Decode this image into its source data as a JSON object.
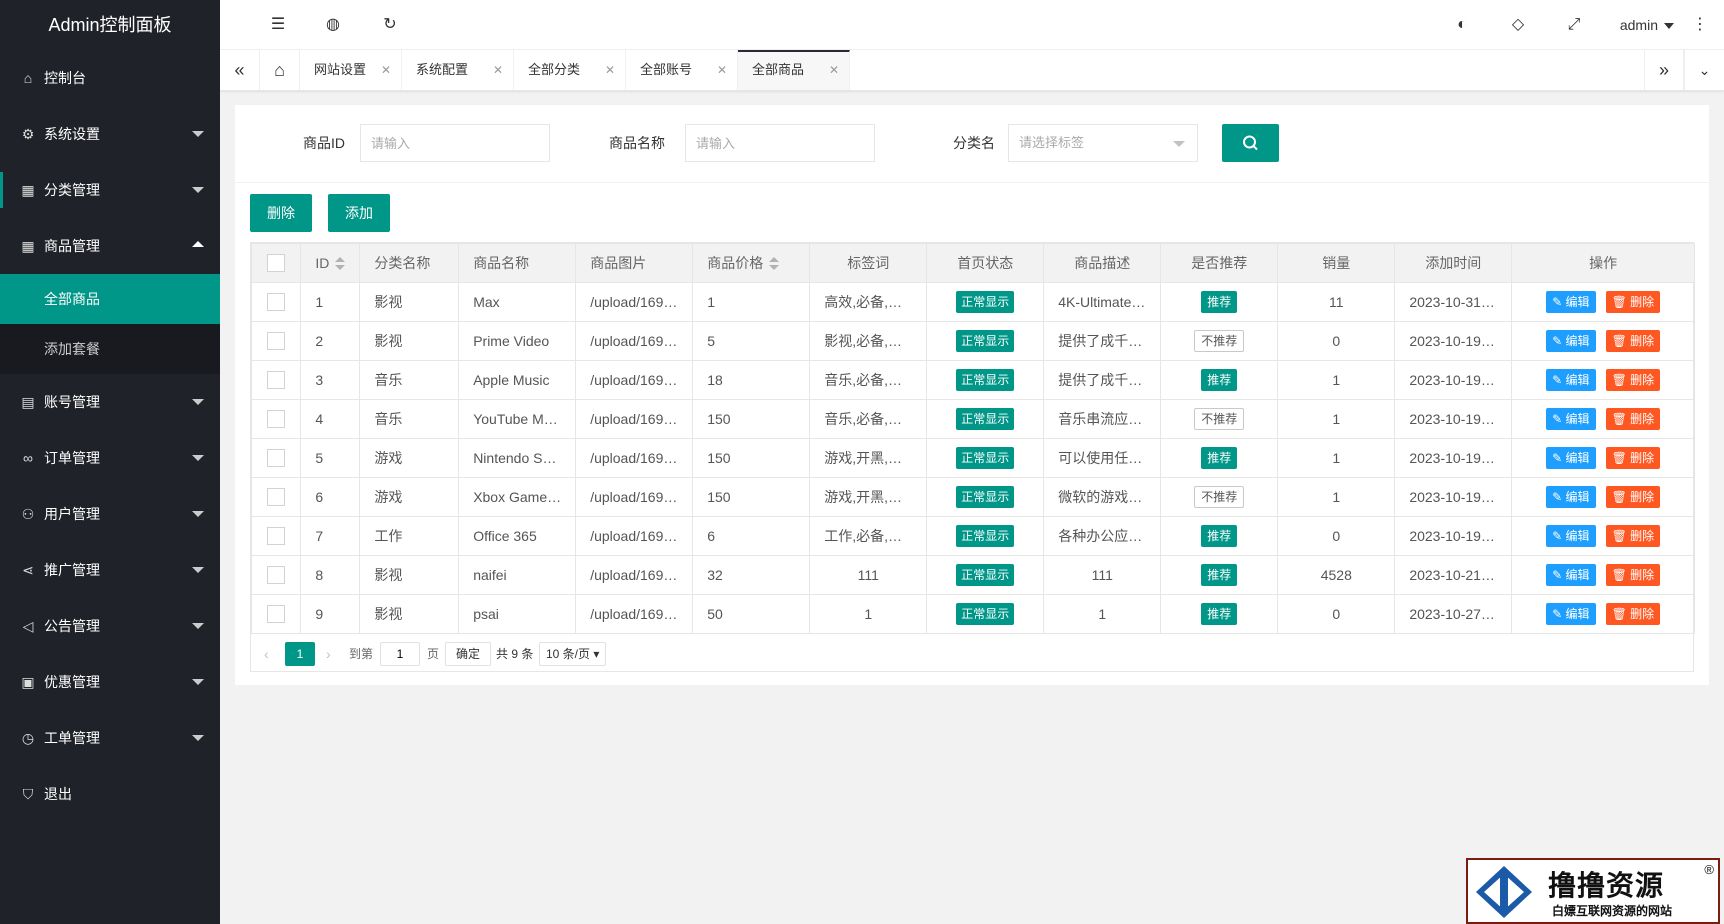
{
  "brand": "Admin控制面板",
  "menu": {
    "dashboard": "控制台",
    "system_settings": "系统设置",
    "category_mgmt": "分类管理",
    "product_mgmt": "商品管理",
    "all_products": "全部商品",
    "add_package": "添加套餐",
    "account_mgmt": "账号管理",
    "order_mgmt": "订单管理",
    "user_mgmt": "用户管理",
    "promo_mgmt": "推广管理",
    "notice_mgmt": "公告管理",
    "discount_mgmt": "优惠管理",
    "ticket_mgmt": "工单管理",
    "logout": "退出"
  },
  "header": {
    "user": "admin"
  },
  "tabs": [
    "网站设置",
    "系统配置",
    "全部分类",
    "全部账号",
    "全部商品"
  ],
  "search": {
    "id_label": "商品ID",
    "id_placeholder": "请输入",
    "name_label": "商品名称",
    "name_placeholder": "请输入",
    "category_label": "分类名",
    "category_placeholder": "请选择标签"
  },
  "toolbar": {
    "delete_label": "删除",
    "add_label": "添加"
  },
  "table": {
    "headers": [
      "ID",
      "分类名称",
      "商品名称",
      "商品图片",
      "商品价格",
      "标签词",
      "首页状态",
      "商品描述",
      "是否推荐",
      "销量",
      "添加时间",
      "操作"
    ],
    "status_label": "正常显示",
    "recommend_label": "推荐",
    "not_recommend_label": "不推荐",
    "edit_label": "编辑",
    "delete_label": "删除",
    "rows": [
      {
        "id": "1",
        "category": "影视",
        "name": "Max",
        "image": "/upload/169…",
        "price": "1",
        "tags": "高效,必备,…",
        "desc": "4K-Ultimate…",
        "recommend": true,
        "sales": "11",
        "time": "2023-10-31…"
      },
      {
        "id": "2",
        "category": "影视",
        "name": "Prime Video",
        "image": "/upload/169…",
        "price": "5",
        "tags": "影视,必备,…",
        "desc": "提供了成千…",
        "recommend": false,
        "sales": "0",
        "time": "2023-10-19…"
      },
      {
        "id": "3",
        "category": "音乐",
        "name": "Apple Music",
        "image": "/upload/169…",
        "price": "18",
        "tags": "音乐,必备,…",
        "desc": "提供了成千…",
        "recommend": true,
        "sales": "1",
        "time": "2023-10-19…"
      },
      {
        "id": "4",
        "category": "音乐",
        "name": "YouTube M…",
        "image": "/upload/169…",
        "price": "150",
        "tags": "音乐,必备,…",
        "desc": "音乐串流应…",
        "recommend": false,
        "sales": "1",
        "time": "2023-10-19…"
      },
      {
        "id": "5",
        "category": "游戏",
        "name": "Nintendo S…",
        "image": "/upload/169…",
        "price": "150",
        "tags": "游戏,开黑,…",
        "desc": "可以使用任…",
        "recommend": true,
        "sales": "1",
        "time": "2023-10-19…"
      },
      {
        "id": "6",
        "category": "游戏",
        "name": "Xbox Game…",
        "image": "/upload/169…",
        "price": "150",
        "tags": "游戏,开黑,…",
        "desc": "微软的游戏…",
        "recommend": false,
        "sales": "1",
        "time": "2023-10-19…"
      },
      {
        "id": "7",
        "category": "工作",
        "name": "Office 365",
        "image": "/upload/169…",
        "price": "6",
        "tags": "工作,必备,O…",
        "desc": "各种办公应…",
        "recommend": true,
        "sales": "0",
        "time": "2023-10-19…"
      },
      {
        "id": "8",
        "category": "影视",
        "name": "naifei",
        "image": "/upload/169…",
        "price": "32",
        "tags": "111",
        "desc": "111",
        "recommend": true,
        "sales": "4528",
        "time": "2023-10-21…",
        "center_text": true
      },
      {
        "id": "9",
        "category": "影视",
        "name": "psai",
        "image": "/upload/169…",
        "price": "50",
        "tags": "1",
        "desc": "1",
        "recommend": true,
        "sales": "0",
        "time": "2023-10-27…",
        "center_text": true
      }
    ]
  },
  "pager": {
    "current": "1",
    "goto_label": "到第",
    "page_value": "1",
    "page_unit": "页",
    "confirm": "确定",
    "total": "共 9 条",
    "page_size": "10 条/页"
  },
  "watermark": {
    "title": "撸撸资源",
    "subtitle": "白嫖互联网资源的网站",
    "reg": "®"
  },
  "colors": {
    "sidebar_bg": "#20222a",
    "accent": "#009688",
    "edit_blue": "#1e9fff",
    "delete_red": "#ff5722"
  }
}
